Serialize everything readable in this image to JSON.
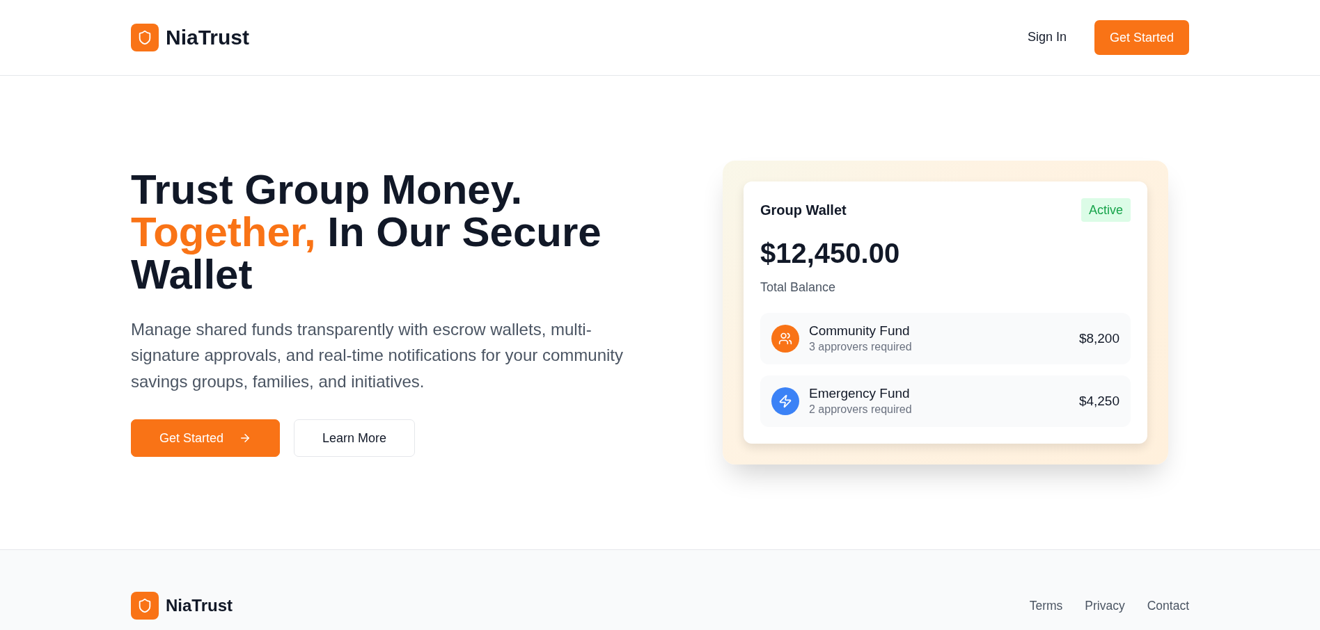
{
  "header": {
    "brand": "NiaTrust",
    "nav": [
      {
        "label": "Sign In",
        "kind": "link"
      },
      {
        "label": "Get Started",
        "kind": "button"
      }
    ]
  },
  "hero": {
    "title_line": "Trust Group Money.",
    "title_highlight": "Together,",
    "title_rest": "In Our Secure Wallet",
    "description": "Manage shared funds transparently with escrow wallets, multi-signature approvals, and real-time notifications for your community savings groups, families, and initiatives.",
    "buttons": [
      {
        "label": "Get Started",
        "kind": "primary"
      },
      {
        "label": "Learn More",
        "kind": "secondary"
      }
    ]
  },
  "wallet_card": {
    "title": "Group Wallet",
    "status": "Active",
    "balance": "$12,450.00",
    "balance_label": "Total Balance",
    "funds": [
      {
        "name": "Community Fund",
        "approvers": "3 approvers required",
        "amount": "$8,200",
        "kind": "community",
        "color": "#f97316"
      },
      {
        "name": "Emergency Fund",
        "approvers": "2 approvers required",
        "amount": "$4,250",
        "kind": "emergency",
        "color": "#3b82f6"
      }
    ]
  },
  "footer": {
    "brand": "NiaTrust",
    "links": [
      "Terms",
      "Privacy",
      "Contact"
    ]
  }
}
